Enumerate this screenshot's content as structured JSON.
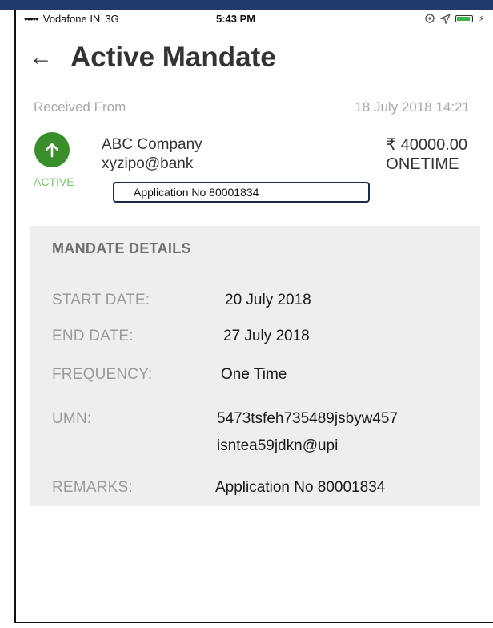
{
  "status_bar": {
    "signal": "•••••",
    "carrier": "Vodafone IN",
    "network": "3G",
    "time": "5:43 PM",
    "icons": [
      "location-icon",
      "navigation-icon",
      "battery-icon"
    ]
  },
  "header": {
    "back_icon": "←",
    "title": "Active Mandate"
  },
  "received": {
    "label": "Received From",
    "datetime": "18 July 2018 14:21"
  },
  "mandate_summary": {
    "status": "ACTIVE",
    "status_color": "#3b8e2c",
    "payee_name": "ABC Company",
    "payee_vpa": "xyzipo@bank",
    "amount": "₹ 40000.00",
    "recurrence": "ONETIME",
    "application_note": "Application No 80001834"
  },
  "details": {
    "heading": "MANDATE DETAILS",
    "start_date_label": "START DATE:",
    "start_date": "20 July 2018",
    "end_date_label": "END DATE:",
    "end_date": "27 July 2018",
    "frequency_label": "FREQUENCY:",
    "frequency": "One Time",
    "umn_label": "UMN:",
    "umn_line1": "5473tsfeh735489jsbyw457",
    "umn_line2": "isntea59jdkn@upi",
    "remarks_label": "REMARKS:",
    "remarks": "Application No 80001834"
  }
}
